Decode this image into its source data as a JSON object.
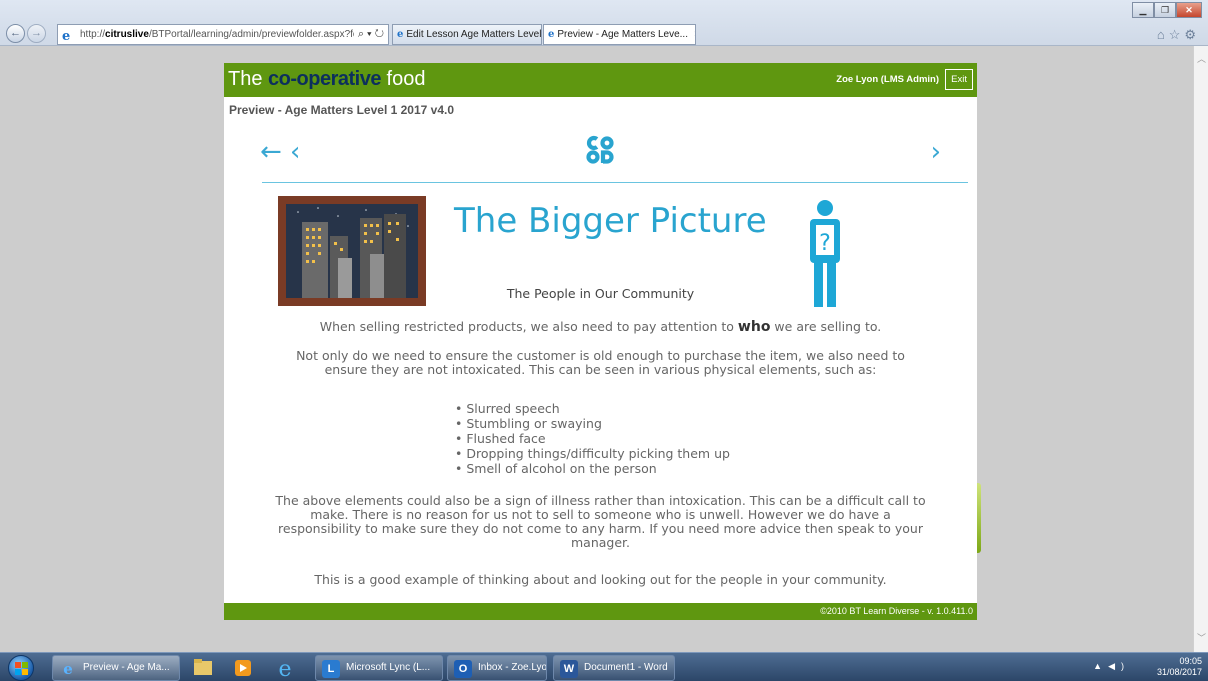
{
  "browser": {
    "url_prefix": "http://",
    "url_host": "citruslive",
    "url_path": "/BTPortal/learning/admin/previewfolder.aspx?folder",
    "address_controls": "⌕ ▾ ↻",
    "tabs": [
      {
        "label": "Edit Lesson Age Matters Level ..."
      },
      {
        "label": "Preview - Age Matters Leve..."
      }
    ],
    "tab_close": "×"
  },
  "portal": {
    "brand_the": "The ",
    "brand_coop": "co-operative",
    "brand_food": " food",
    "user": "Zoe Lyon (LMS Admin)",
    "exit_label": "Exit",
    "preview_title": "Preview - Age Matters Level 1 2017 v4.0",
    "footer": "©2010 BT Learn Diverse - v. 1.0.411.0"
  },
  "lesson": {
    "nav_back": "← ‹",
    "nav_next": "›",
    "title": "The Bigger Picture",
    "subtitle": "The People in Our Community",
    "p1_before": "When selling restricted products, we also need to pay attention to ",
    "p1_bold": "who",
    "p1_after": " we are selling to.",
    "p2": "Not only do we need to ensure the customer is old enough to purchase the item, we also need to ensure they are not intoxicated. This can be seen in various physical elements, such as:",
    "bullets": [
      "Slurred speech",
      "Stumbling or swaying",
      "Flushed face",
      "Dropping things/difficulty picking them up",
      "Smell of alcohol on the person"
    ],
    "p3": "The above elements could also be a sign of illness rather than intoxication. This can be a difficult call to make. There is no reason for us not to sell to someone who is unwell. However we do have a responsibility to make sure they do not come to any harm. If you need more advice then speak to your manager.",
    "p4": "This is a good example of thinking about and looking out for the people in your community.",
    "person_mark": "?"
  },
  "taskbar": {
    "items": [
      {
        "label": "Preview - Age Ma...",
        "icon": "ie-icon"
      },
      {
        "label": "Microsoft Lync  (L...",
        "icon": "lync-icon"
      },
      {
        "label": "Inbox - Zoe.Lyon...",
        "icon": "outlook-icon"
      },
      {
        "label": "Document1 - Word",
        "icon": "word-icon"
      }
    ],
    "time": "09:05",
    "date": "31/08/2017"
  },
  "colors": {
    "brand_green": "#5f9710",
    "brand_navy": "#0c2f5d",
    "accent_blue": "#29a4cf"
  }
}
